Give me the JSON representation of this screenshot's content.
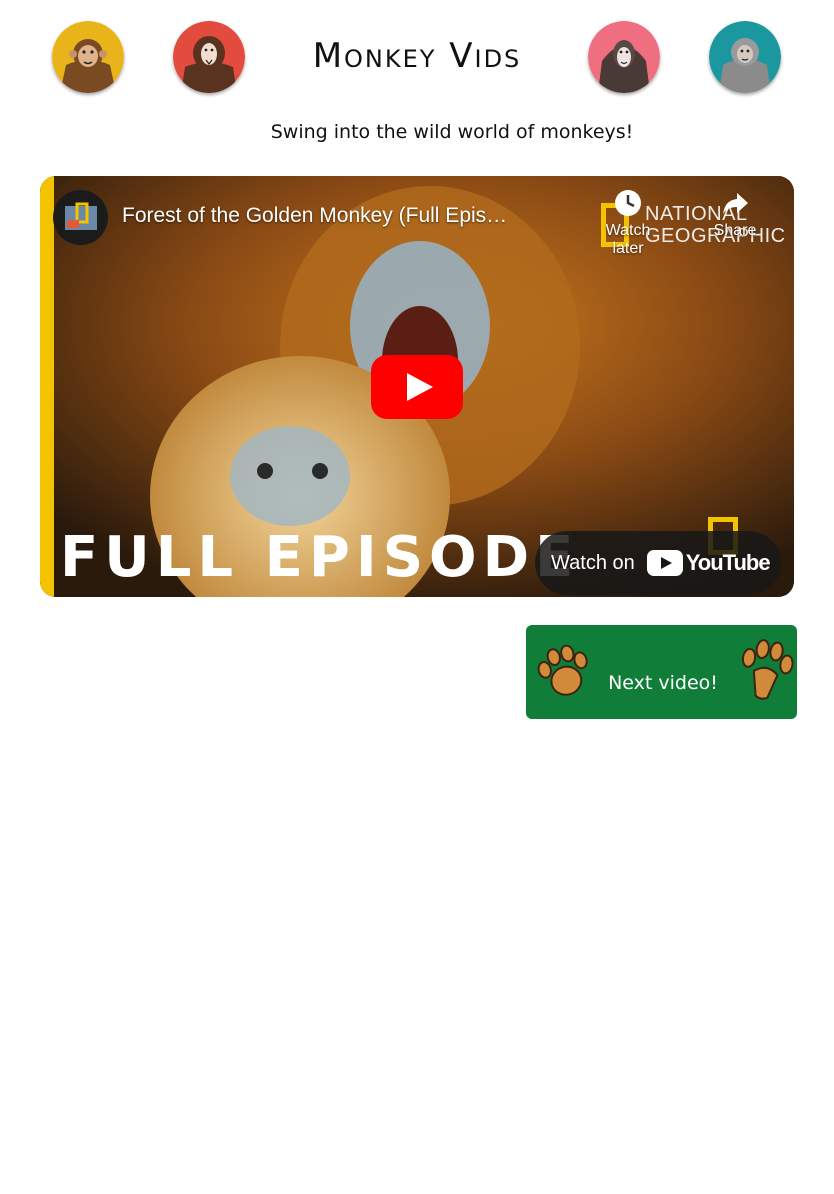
{
  "header": {
    "title": "Monkey Vids",
    "tagline": "Swing into the wild world of monkeys!",
    "avatars": [
      {
        "icon": "golden-monkey-icon",
        "color": "#e8b419"
      },
      {
        "icon": "red-monkey-icon",
        "color": "#e24b3d"
      },
      {
        "icon": "pink-monkey-icon",
        "color": "#ef6f80"
      },
      {
        "icon": "teal-monkey-icon",
        "color": "#1b97a0"
      }
    ]
  },
  "video": {
    "title": "Forest of the Golden Monkey (Full Epis…",
    "watch_later_label": "Watch later",
    "share_label": "Share",
    "brand_text": "NATIONAL GEOGRAPHIC",
    "overlay_text": "FULL EPISODE",
    "watch_on_label": "Watch on",
    "youtube_label": "YouTube",
    "brand_color": "#f4c300",
    "play_color": "#ff0000"
  },
  "next": {
    "label": "Next video!",
    "color": "#107d38",
    "icon": "paw-icon"
  }
}
